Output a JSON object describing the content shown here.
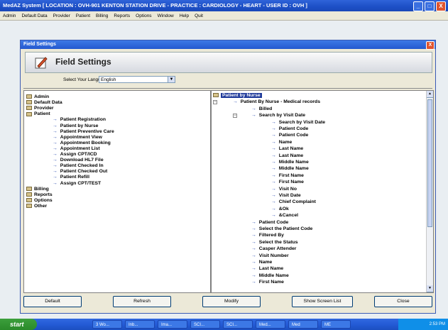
{
  "app": {
    "title": "MedAZ System [ LOCATION : OVH-901 KENTON STATION DRIVE - PRACTICE : CARDIOLOGY - HEART - USER ID : OVH ]",
    "minimize": "_",
    "maximize": "□",
    "close": "X"
  },
  "menu": [
    "Admin",
    "Default Data",
    "Provider",
    "Patient",
    "Billing",
    "Reports",
    "Options",
    "Window",
    "Help",
    "Quit"
  ],
  "dialog": {
    "title": "Field Settings",
    "header": "Field Settings",
    "close": "X"
  },
  "language": {
    "label": "Select Your Language :",
    "value": "English"
  },
  "left_tree": [
    {
      "text": "Admin",
      "type": "root"
    },
    {
      "text": "Default Data",
      "type": "root"
    },
    {
      "text": "Provider",
      "type": "root"
    },
    {
      "text": "Patient",
      "type": "root"
    },
    {
      "text": "Patient Registration",
      "type": "child"
    },
    {
      "text": "Patient by Nurse",
      "type": "child"
    },
    {
      "text": "Patient Preventive Care",
      "type": "child"
    },
    {
      "text": "Appointment View",
      "type": "child"
    },
    {
      "text": "Appointment Booking",
      "type": "child"
    },
    {
      "text": "Appointment List",
      "type": "child"
    },
    {
      "text": "Assign CPT/ICD",
      "type": "child"
    },
    {
      "text": "Download HL7 File",
      "type": "child"
    },
    {
      "text": "Patient Checked In",
      "type": "child"
    },
    {
      "text": "Patient Checked Out",
      "type": "child"
    },
    {
      "text": "Patient Refill",
      "type": "child"
    },
    {
      "text": "Assign CPT/TEST",
      "type": "child"
    },
    {
      "text": "Billing",
      "type": "root"
    },
    {
      "text": "Reports",
      "type": "root"
    },
    {
      "text": "Options",
      "type": "root"
    },
    {
      "text": "Other",
      "type": "root"
    }
  ],
  "right_tree": [
    {
      "text": "Patient by Nurse",
      "level": 0
    },
    {
      "text": "Patient By Nurse - Medical records",
      "level": 1
    },
    {
      "text": "Billed",
      "level": 2
    },
    {
      "text": "Search by Visit Date",
      "level": 2
    },
    {
      "text": "Search by Visit Date",
      "level": 3
    },
    {
      "text": "Patient Code",
      "level": 3
    },
    {
      "text": "Patient Code",
      "level": 3
    },
    {
      "text": "Name",
      "level": 3
    },
    {
      "text": "Last Name",
      "level": 3
    },
    {
      "text": "Last Name",
      "level": 3
    },
    {
      "text": "Middle Name",
      "level": 3
    },
    {
      "text": "Middle Name",
      "level": 3
    },
    {
      "text": "First Name",
      "level": 3
    },
    {
      "text": "First Name",
      "level": 3
    },
    {
      "text": "Visit No",
      "level": 3
    },
    {
      "text": "Visit Date",
      "level": 3
    },
    {
      "text": "Chief Complaint",
      "level": 3
    },
    {
      "text": "&Ok",
      "level": 3
    },
    {
      "text": "&Cancel",
      "level": 3
    },
    {
      "text": "Patient Code",
      "level": 2
    },
    {
      "text": "Select the Patient Code",
      "level": 2
    },
    {
      "text": "Filtered By",
      "level": 2
    },
    {
      "text": "Select the Status",
      "level": 2
    },
    {
      "text": "Casper Attender",
      "level": 2
    },
    {
      "text": "Visit Number",
      "level": 2
    },
    {
      "text": "Name",
      "level": 2
    },
    {
      "text": "Last Name",
      "level": 2
    },
    {
      "text": "Middle Name",
      "level": 2
    },
    {
      "text": "First Name",
      "level": 2
    }
  ],
  "buttons": {
    "default": "Default",
    "refresh": "Refresh",
    "modify": "Modify",
    "show_screen_list": "Show Screen List",
    "close": "Close"
  },
  "taskbar": {
    "start": "start",
    "tasks": [
      "3 Wo...",
      "Inb...",
      "Ima...",
      "SCI...",
      "SCI...",
      "Med...",
      "Med",
      "ME"
    ],
    "clock": "2:53 PM"
  }
}
